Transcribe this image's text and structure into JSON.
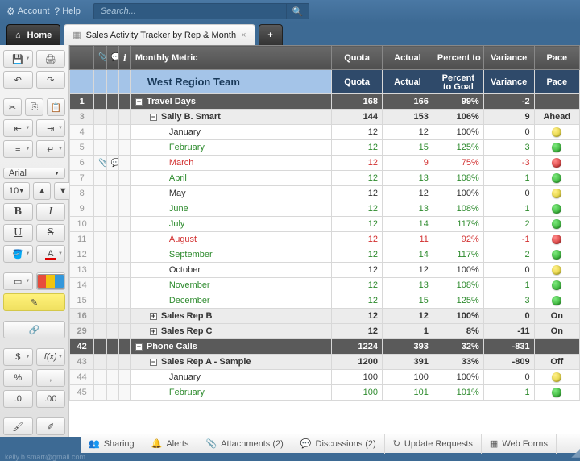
{
  "topnav": {
    "account": "Account",
    "help": "Help",
    "search_placeholder": "Search..."
  },
  "tabs": {
    "home": "Home",
    "sheet": "Sales Activity Tracker by Rep & Month"
  },
  "toolbar": {
    "font": "Arial",
    "size": "10",
    "currency": "$",
    "fx": "f(x)",
    "percent": "%",
    "comma": ",",
    "decimal": ".0"
  },
  "columns": {
    "metric": "Monthly Metric",
    "quota": "Quota",
    "actual": "Actual",
    "pct": "Percent to Goal",
    "variance": "Variance",
    "pace": "Pace"
  },
  "section": {
    "title": "West Region Team"
  },
  "rows": [
    {
      "n": 1,
      "type": "group",
      "label": "Travel Days",
      "quota": "168",
      "actual": "166",
      "pct": "99%",
      "variance": "-2",
      "pace": ""
    },
    {
      "n": 3,
      "type": "subhead",
      "label": "Sally B. Smart",
      "quota": "144",
      "actual": "153",
      "pct": "106%",
      "variance": "9",
      "pace": "Ahead"
    },
    {
      "n": 4,
      "type": "month",
      "label": "January",
      "quota": "12",
      "actual": "12",
      "pct": "100%",
      "variance": "0",
      "dot": "y"
    },
    {
      "n": 5,
      "type": "month",
      "cls": "green",
      "label": "February",
      "quota": "12",
      "actual": "15",
      "pct": "125%",
      "variance": "3",
      "dot": "g"
    },
    {
      "n": 6,
      "type": "month",
      "cls": "red-text",
      "label": "March",
      "quota": "12",
      "actual": "9",
      "pct": "75%",
      "variance": "-3",
      "dot": "r",
      "attach": true,
      "disc": true
    },
    {
      "n": 7,
      "type": "month",
      "cls": "green",
      "label": "April",
      "quota": "12",
      "actual": "13",
      "pct": "108%",
      "variance": "1",
      "dot": "g"
    },
    {
      "n": 8,
      "type": "month",
      "label": "May",
      "quota": "12",
      "actual": "12",
      "pct": "100%",
      "variance": "0",
      "dot": "y"
    },
    {
      "n": 9,
      "type": "month",
      "cls": "green",
      "label": "June",
      "quota": "12",
      "actual": "13",
      "pct": "108%",
      "variance": "1",
      "dot": "g"
    },
    {
      "n": 10,
      "type": "month",
      "cls": "green",
      "label": "July",
      "quota": "12",
      "actual": "14",
      "pct": "117%",
      "variance": "2",
      "dot": "g"
    },
    {
      "n": 11,
      "type": "month",
      "cls": "red-text",
      "label": "August",
      "quota": "12",
      "actual": "11",
      "pct": "92%",
      "variance": "-1",
      "dot": "r"
    },
    {
      "n": 12,
      "type": "month",
      "cls": "green",
      "label": "September",
      "quota": "12",
      "actual": "14",
      "pct": "117%",
      "variance": "2",
      "dot": "g"
    },
    {
      "n": 13,
      "type": "month",
      "label": "October",
      "quota": "12",
      "actual": "12",
      "pct": "100%",
      "variance": "0",
      "dot": "y"
    },
    {
      "n": 14,
      "type": "month",
      "cls": "green",
      "label": "November",
      "quota": "12",
      "actual": "13",
      "pct": "108%",
      "variance": "1",
      "dot": "g"
    },
    {
      "n": 15,
      "type": "month",
      "cls": "green",
      "label": "December",
      "quota": "12",
      "actual": "15",
      "pct": "125%",
      "variance": "3",
      "dot": "g"
    },
    {
      "n": 16,
      "type": "summary",
      "exp": "+",
      "label": "Sales Rep B",
      "quota": "12",
      "actual": "12",
      "pct": "100%",
      "variance": "0",
      "pace": "On"
    },
    {
      "n": 29,
      "type": "summary",
      "exp": "+",
      "label": "Sales Rep C",
      "quota": "12",
      "actual": "1",
      "pct": "8%",
      "variance": "-11",
      "pace": "On"
    },
    {
      "n": 42,
      "type": "group",
      "label": "Phone Calls",
      "quota": "1224",
      "actual": "393",
      "pct": "32%",
      "variance": "-831",
      "pace": ""
    },
    {
      "n": 43,
      "type": "subhead",
      "label": "Sales Rep A - Sample",
      "quota": "1200",
      "actual": "391",
      "pct": "33%",
      "variance": "-809",
      "pace": "Off"
    },
    {
      "n": 44,
      "type": "month",
      "label": "January",
      "quota": "100",
      "actual": "100",
      "pct": "100%",
      "variance": "0",
      "dot": "y"
    },
    {
      "n": 45,
      "type": "month",
      "cls": "green",
      "label": "February",
      "quota": "100",
      "actual": "101",
      "pct": "101%",
      "variance": "1",
      "dot": "g"
    }
  ],
  "bottom": {
    "sharing": "Sharing",
    "alerts": "Alerts",
    "attachments": "Attachments  (2)",
    "discussions": "Discussions  (2)",
    "updates": "Update Requests",
    "forms": "Web Forms"
  },
  "footer_email": "kelly.b.smart@gmail.com"
}
